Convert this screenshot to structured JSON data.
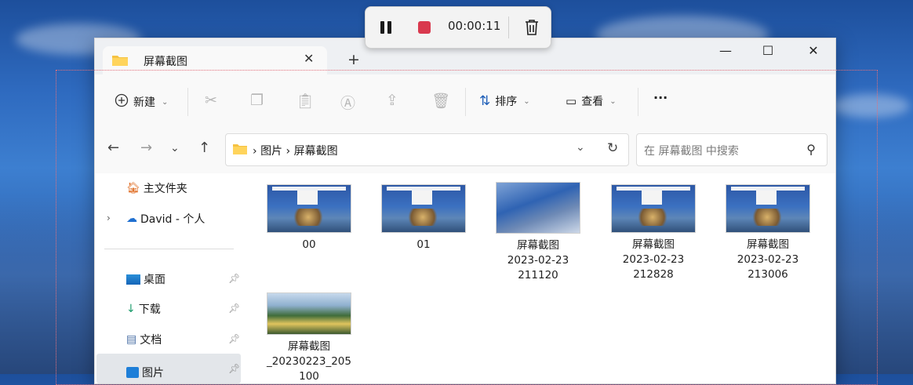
{
  "recorder": {
    "time": "00:00:11"
  },
  "tab": {
    "title": "屏幕截图",
    "close": "✕",
    "new": "+"
  },
  "window_controls": {
    "minimize": "—",
    "maximize": "☐",
    "close": "✕"
  },
  "toolbar": {
    "new_label": "新建",
    "sort_label": "排序",
    "view_label": "查看",
    "more_label": "···"
  },
  "address": {
    "path": [
      "图片",
      "屏幕截图"
    ],
    "separator": "›"
  },
  "search": {
    "placeholder": "在 屏幕截图 中搜索"
  },
  "sidebar": {
    "items": [
      {
        "label": "主文件夹",
        "icon": "home-icon"
      },
      {
        "label": "David - 个人",
        "icon": "cloud-icon"
      },
      {
        "label": "桌面",
        "icon": "desktop-icon",
        "pinned": true
      },
      {
        "label": "下载",
        "icon": "download-icon",
        "pinned": true
      },
      {
        "label": "文档",
        "icon": "document-icon",
        "pinned": true
      },
      {
        "label": "图片",
        "icon": "pictures-icon",
        "pinned": true,
        "selected": true
      }
    ]
  },
  "files": [
    {
      "name": "00",
      "thumb": "screenshot"
    },
    {
      "name": "01",
      "thumb": "screenshot"
    },
    {
      "name_lines": [
        "屏幕截图",
        "2023-02-23",
        "211120"
      ],
      "thumb": "mountain"
    },
    {
      "name_lines": [
        "屏幕截图",
        "2023-02-23",
        "212828"
      ],
      "thumb": "screenshot"
    },
    {
      "name_lines": [
        "屏幕截图",
        "2023-02-23",
        "213006"
      ],
      "thumb": "screenshot"
    },
    {
      "name_lines": [
        "屏幕截图",
        "_20230223_205",
        "100"
      ],
      "thumb": "lake"
    }
  ],
  "colors": {
    "record_red": "#d9394e",
    "capture_border": "#e2707c",
    "folder_yellow": "#f5c242"
  }
}
